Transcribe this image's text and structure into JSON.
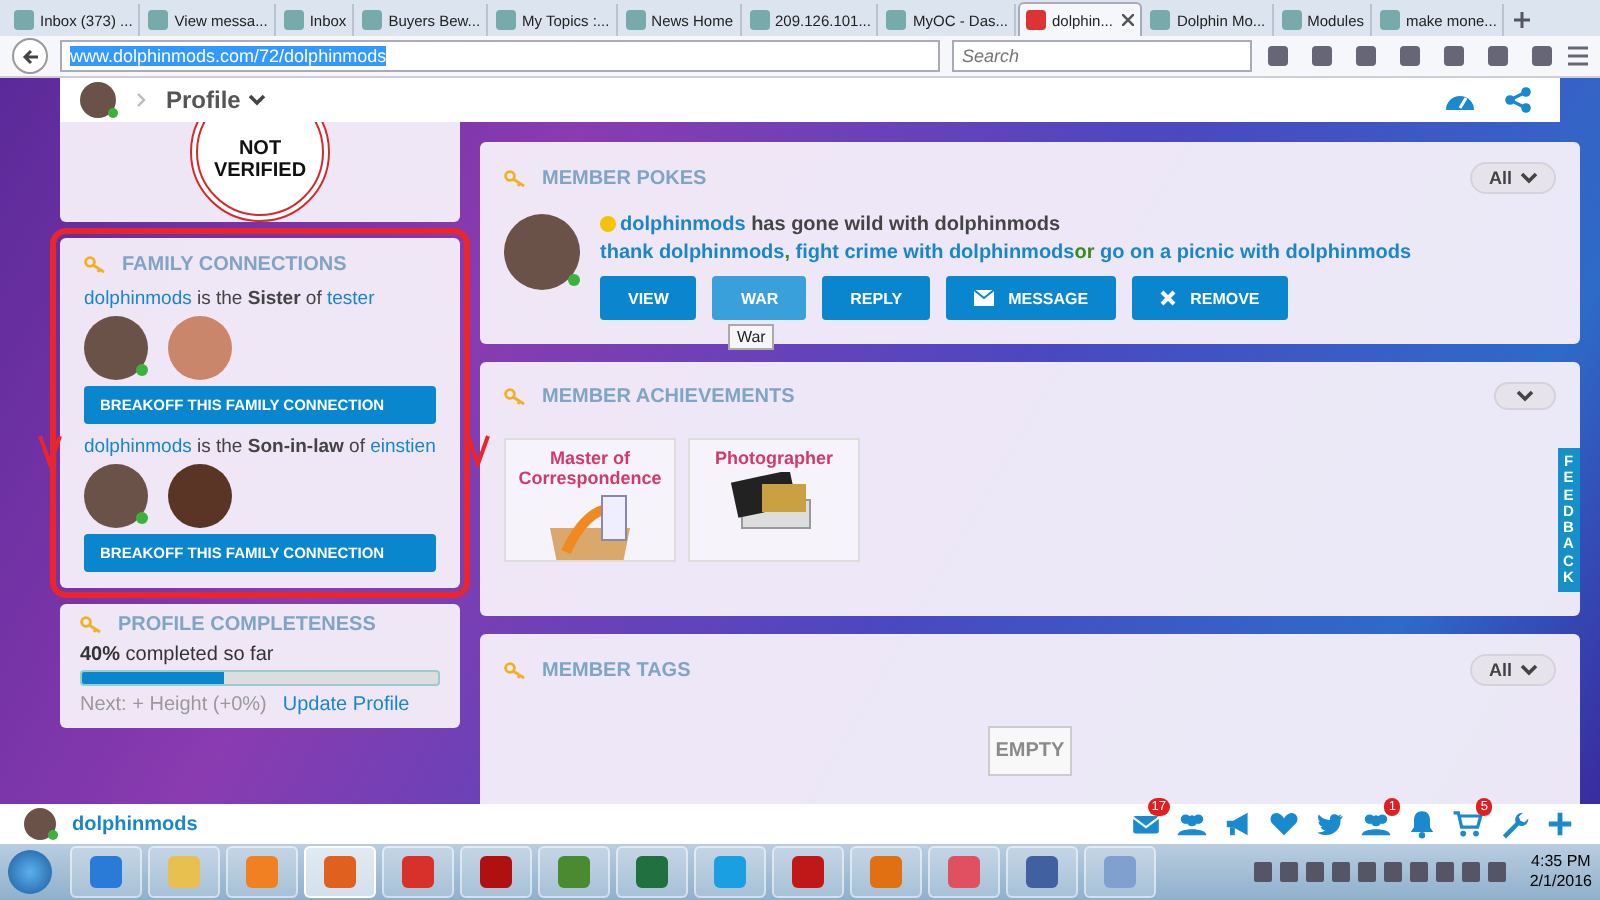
{
  "browser": {
    "tabs": [
      {
        "title": "Inbox (373) ...",
        "selected": false
      },
      {
        "title": "View messa...",
        "selected": false
      },
      {
        "title": "Inbox",
        "selected": false
      },
      {
        "title": "Buyers Bew...",
        "selected": false
      },
      {
        "title": "My Topics :...",
        "selected": false
      },
      {
        "title": "News Home",
        "selected": false
      },
      {
        "title": "209.126.101...",
        "selected": false
      },
      {
        "title": "MyOC - Das...",
        "selected": false
      },
      {
        "title": "dolphin...",
        "selected": true
      },
      {
        "title": "Dolphin Mo...",
        "selected": false
      },
      {
        "title": "Modules",
        "selected": false
      },
      {
        "title": "make mone...",
        "selected": false
      }
    ],
    "url": "www.dolphinmods.com/72/dolphinmods",
    "search": {
      "placeholder": "Search"
    }
  },
  "profile_bar": {
    "title": "Profile",
    "online": true
  },
  "verification": {
    "stamp": "NOT VERIFIED"
  },
  "family_connections": {
    "title": "FAMILY CONNECTIONS",
    "highlighted": true,
    "connections": [
      {
        "member": "dolphinmods",
        "joiner": "is the",
        "relation": "Sister",
        "preposition": "of",
        "target": "tester",
        "member_online": true,
        "button": "BREAKOFF THIS FAMILY CONNECTION"
      },
      {
        "member": "dolphinmods",
        "joiner": "is the",
        "relation": "Son-in-law",
        "preposition": "of",
        "target": "einstien",
        "member_online": true,
        "button": "BREAKOFF THIS FAMILY CONNECTION"
      }
    ]
  },
  "profile_completeness": {
    "title": "PROFILE COMPLETENESS",
    "summary": "**40%** completed so far",
    "level": 0.4,
    "next": "Next: + Height (+0%)",
    "link": "Update Profile"
  },
  "member_pokes": {
    "title": "MEMBER POKES",
    "filter": "All",
    "poke": {
      "member": "dolphinmods",
      "text": "has gone wild with dolphinmods",
      "online": true
    },
    "links": [
      "thank dolphinmods",
      "fight crime with dolphinmods",
      "go on a picnic with dolphinmods"
    ],
    "joiners": [
      ",",
      "or"
    ],
    "buttons": [
      {
        "label": "VIEW",
        "kind": "plain",
        "hovered": false
      },
      {
        "label": "WAR",
        "kind": "plain",
        "hovered": true
      },
      {
        "label": "REPLY",
        "kind": "plain",
        "hovered": false
      },
      {
        "label": "MESSAGE",
        "kind": "envelope",
        "hovered": false
      },
      {
        "label": "REMOVE",
        "kind": "cross",
        "hovered": false
      }
    ],
    "tooltip": "War"
  },
  "member_achievements": {
    "title": "MEMBER ACHIEVEMENTS",
    "badges": [
      {
        "name": "Master of Correspondence",
        "kind": "mail"
      },
      {
        "name": "Photographer",
        "kind": "photo"
      }
    ]
  },
  "member_tags": {
    "title": "MEMBER TAGS",
    "filter": "All",
    "empty": "EMPTY"
  },
  "feedback": "FEEDBACK",
  "user_bar": {
    "name": "dolphinmods",
    "online": true,
    "icons": [
      {
        "kind": "mail",
        "badge": "17"
      },
      {
        "kind": "group"
      },
      {
        "kind": "megaphone"
      },
      {
        "kind": "heart"
      },
      {
        "kind": "bird"
      },
      {
        "kind": "group",
        "badge": "1"
      },
      {
        "kind": "bell"
      },
      {
        "kind": "cart",
        "badge": "5"
      },
      {
        "kind": "wrench"
      },
      {
        "kind": "plus"
      }
    ]
  },
  "taskbar": {
    "apps": [
      {
        "kind": "browser-e",
        "active": false
      },
      {
        "kind": "folder",
        "active": false
      },
      {
        "kind": "media",
        "active": false
      },
      {
        "kind": "fox",
        "active": true
      },
      {
        "kind": "wheel",
        "active": false
      },
      {
        "kind": "fz",
        "active": false
      },
      {
        "kind": "frog",
        "active": false
      },
      {
        "kind": "sheet",
        "active": false
      },
      {
        "kind": "chat",
        "active": false
      },
      {
        "kind": "pdf",
        "active": false
      },
      {
        "kind": "mailapp",
        "active": false
      },
      {
        "kind": "eraser",
        "active": false
      },
      {
        "kind": "dict",
        "active": false
      },
      {
        "kind": "paint",
        "active": false
      }
    ],
    "time": "4:35 PM",
    "date": "2/1/2016"
  }
}
